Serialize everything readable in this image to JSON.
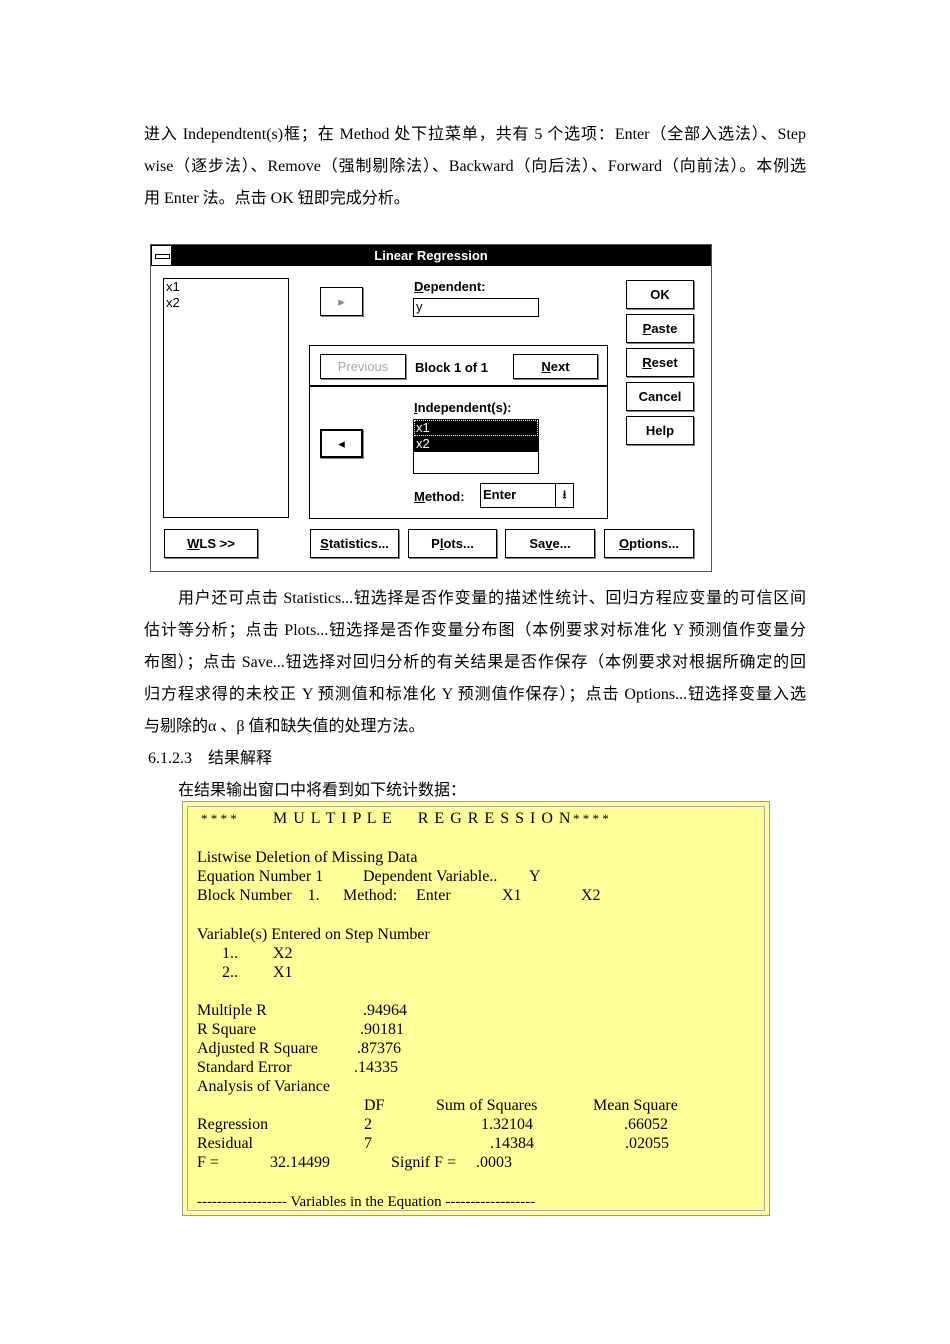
{
  "intro_lines": [
    "进入 Independtent(s)框；在 Method 处下拉菜单，共有 5 个选项：Enter（全部入选法）、Step",
    "wise（逐步法）、Remove（强制剔除法）、Backward（向后法）、Forward（向前法）。本例选",
    "用 Enter 法。点击 OK 钮即完成分析。"
  ],
  "dialog": {
    "title": "Linear Regression",
    "source_vars": [
      "x1",
      "x2"
    ],
    "dependent_label": "Dependent:",
    "dependent_value": "y",
    "previous": "Previous",
    "block": "Block 1 of 1",
    "next": "Next",
    "independent_label": "Independent(s):",
    "independents": [
      "x1",
      "x2"
    ],
    "method_label": "Method:",
    "method_value": "Enter",
    "buttons": {
      "ok": "OK",
      "paste": "Paste",
      "reset": "Reset",
      "cancel": "Cancel",
      "help": "Help",
      "wls": "WLS >>",
      "statistics": "Statistics...",
      "plots": "Plots...",
      "save": "Save...",
      "options": "Options..."
    }
  },
  "body_lines": [
    "用户还可点击 Statistics...钮选择是否作变量的描述性统计、回归方程应变量的可信区间",
    "估计等分析；点击 Plots...钮选择是否作变量分布图（本例要求对标准化 Y 预测值作变量分",
    "布图）；点击 Save...钮选择对回归分析的有关结果是否作保存（本例要求对根据所确定的回",
    "归方程求得的未校正 Y 预测值和标准化 Y 预测值作保存）；点击 Options...钮选择变量入选",
    "与剔除的α 、β 值和缺失值的处理方法。"
  ],
  "section_heading": "6.1.2.3　结果解释",
  "output_intro": "在结果输出窗口中将看到如下统计数据：",
  "output": {
    "header_stars_l": "* * * *",
    "header": "M U L T I P L E     R E G R E S S I O N",
    "header_stars_r": "* * * *",
    "listwise": "Listwise Deletion of Missing Data",
    "eq_label": "Equation Number 1",
    "dep_label": "Dependent Variable..",
    "dep_value": "Y",
    "block_label": "Block Number    1.",
    "method_label": "Method:",
    "method_value": "Enter",
    "vars": [
      "X1",
      "X2"
    ],
    "entered_title": "Variable(s) Entered on Step Number",
    "steps": [
      {
        "n": "1..",
        "v": "X2"
      },
      {
        "n": "2..",
        "v": "X1"
      }
    ],
    "stats": [
      {
        "label": "Multiple R",
        "value": ".94964"
      },
      {
        "label": "R Square",
        "value": ".90181"
      },
      {
        "label": "Adjusted R Square",
        "value": ".87376"
      },
      {
        "label": "Standard Error",
        "value": ".14335"
      }
    ],
    "anova_title": "Analysis of Variance",
    "anova_headers": [
      "DF",
      "Sum of Squares",
      "Mean Square"
    ],
    "anova_rows": [
      {
        "label": "Regression",
        "df": "2",
        "ss": "1.32104",
        "ms": ".66052"
      },
      {
        "label": "Residual",
        "df": "7",
        "ss": ".14384",
        "ms": ".02055"
      }
    ],
    "f_label": "F =",
    "f_value": "32.14499",
    "signif_label": "Signif F =",
    "signif_value": ".0003",
    "footer": "------------------ Variables in the Equation ------------------"
  }
}
